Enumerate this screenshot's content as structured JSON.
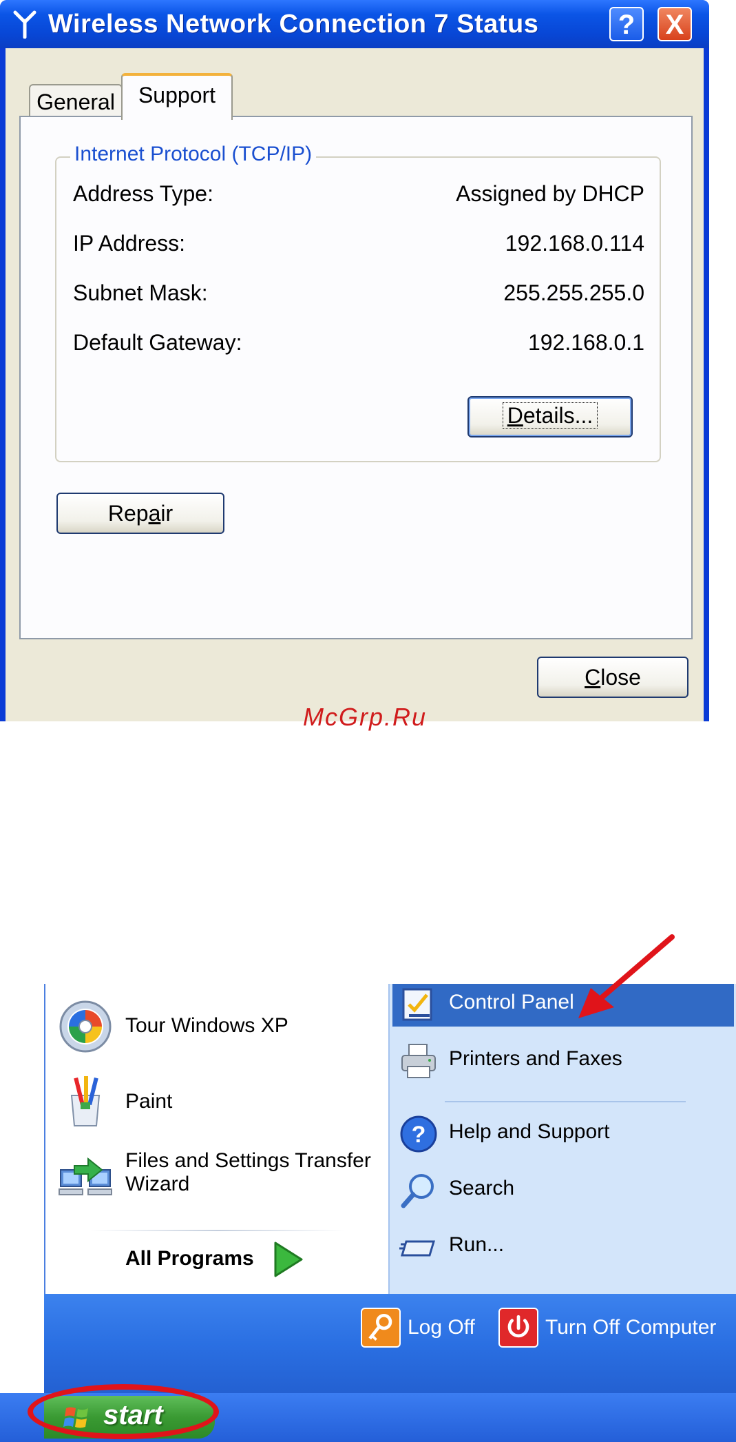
{
  "dialog": {
    "title": "Wireless Network Connection 7 Status",
    "help_button": "?",
    "close_button": "X",
    "tabs": [
      {
        "label": "General"
      },
      {
        "label": "Support"
      }
    ],
    "group_title": "Internet Protocol (TCP/IP)",
    "rows": [
      {
        "label": "Address Type:",
        "value": "Assigned by DHCP"
      },
      {
        "label": "IP Address:",
        "value": "192.168.0.114"
      },
      {
        "label": "Subnet Mask:",
        "value": "255.255.255.0"
      },
      {
        "label": "Default Gateway:",
        "value": "192.168.0.1"
      }
    ],
    "details_button": {
      "pre": "",
      "key": "D",
      "post": "etails..."
    },
    "repair_button": {
      "pre": "Rep",
      "key": "a",
      "post": "ir"
    },
    "close_dialog_button": {
      "pre": "",
      "key": "C",
      "post": "lose"
    }
  },
  "watermark": "McGrp.Ru",
  "start_menu": {
    "left_items": [
      {
        "label": "Tour Windows XP",
        "icon": "tour-windows-icon"
      },
      {
        "label": "Paint",
        "icon": "paint-icon"
      },
      {
        "label": "Files and Settings Transfer",
        "label2": "Wizard",
        "icon": "transfer-wizard-icon"
      }
    ],
    "all_programs": "All Programs",
    "right_items": [
      {
        "label": "Control Panel",
        "icon": "control-panel-icon"
      },
      {
        "label": "Printers and Faxes",
        "icon": "printer-icon"
      },
      {
        "label": "Help and Support",
        "icon": "help-icon"
      },
      {
        "label": "Search",
        "icon": "search-icon"
      },
      {
        "label": "Run...",
        "icon": "run-icon"
      }
    ],
    "log_off": "Log Off",
    "turn_off": "Turn Off Computer",
    "start": "start"
  },
  "colors": {
    "titlebar": "#0b55e6",
    "dialog_face": "#ece9d8",
    "menu_highlight": "#316ac5",
    "annotation_red": "#e0141a",
    "start_green": "#3a9a33"
  }
}
